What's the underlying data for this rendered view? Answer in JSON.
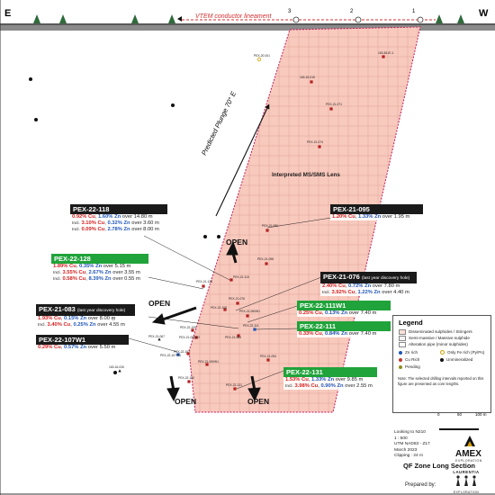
{
  "header": {
    "left_letter": "E",
    "right_letter": "W",
    "lineament_label": "VTEM conductor lineament",
    "markers": [
      "3",
      "2",
      "1"
    ]
  },
  "plunge_label": "Predicted Plunge 70° E",
  "lens_label": "Interpreted MS/SMS Lens",
  "open_labels": [
    "OPEN",
    "OPEN",
    "OPEN",
    "OPEN"
  ],
  "holes": [
    "PEX-20-001",
    "163-83-IE-1",
    "163-15-015",
    "PEX-21-071",
    "PEX-21-074",
    "PEX-21-080",
    "PEX-21-098",
    "PEX-21-128",
    "PEX-22-115",
    "PEX-21-076",
    "PEX-22-108",
    "PEX-21-080W1",
    "PEX-22-111",
    "PEX-22-109",
    "PEX-21-083",
    "PEX-21-090W2",
    "PEX-21-067",
    "PEX-22-107",
    "PEX-22-107W1",
    "PEX-21-090W1",
    "PEX-21-094",
    "PEX-22-100",
    "PEX-22-131",
    "163-16-026"
  ],
  "callouts": [
    {
      "id": "PEX-22-118",
      "style": "dark",
      "lines": [
        {
          "cu": "0.92% Cu",
          "zn": "1.60% Zn",
          "rest": "over 14.80 m"
        },
        {
          "pre": "Incl.",
          "cu": "3.10% Cu",
          "zn": "0.32% Zn",
          "rest": "over 3.60 m"
        },
        {
          "pre": "Incl.",
          "cu": "0.09% Cu",
          "zn": "2.78% Zn",
          "rest": "over 8.00 m"
        }
      ]
    },
    {
      "id": "PEX-21-095",
      "style": "dark",
      "lines": [
        {
          "cu": "1.20% Cu",
          "zn": "1.33% Zn",
          "rest": "over 1.95 m"
        }
      ]
    },
    {
      "id": "PEX-22-128",
      "style": "green",
      "lines": [
        {
          "cu": "1.89% Cu",
          "zn": "0.35% Zn",
          "rest": "over 5.15 m"
        },
        {
          "pre": "Incl.",
          "cu": "3.55% Cu",
          "zn": "2.67% Zn",
          "rest": "over 3.55 m"
        },
        {
          "pre": "Incl.",
          "cu": "0.58% Cu",
          "zn": "8.39% Zn",
          "rest": "over 0.55 m"
        }
      ]
    },
    {
      "id": "PEX-21-076",
      "note": "(last year discovery hole)",
      "style": "dark",
      "lines": [
        {
          "cu": "2.40% Cu",
          "zn": "0.72% Zn",
          "rest": "over 7.80 m"
        },
        {
          "pre": "Incl.",
          "cu": "3.92% Cu",
          "zn": "1.22% Zn",
          "rest": "over 4.40 m"
        }
      ]
    },
    {
      "id": "PEX-21-083",
      "note": "(last year discovery hole)",
      "style": "dark",
      "lines": [
        {
          "cu": "1.93% Cu",
          "zn": "0.15% Zn",
          "rest": "over 8.00 m"
        },
        {
          "pre": "Incl.",
          "cu": "3.40% Cu",
          "zn": "0.25% Zn",
          "rest": "over 4.55 m"
        }
      ]
    },
    {
      "id": "PEX-22-111W1",
      "style": "green",
      "lines": [
        {
          "cu": "0.25% Cu",
          "zn": "0.13% Zn",
          "rest": "over 7.40 m"
        }
      ]
    },
    {
      "id": "PEX-22-111",
      "style": "green",
      "lines": [
        {
          "cu": "0.33% Cu",
          "zn": "0.84% Zn",
          "rest": "over 7.40 m"
        }
      ]
    },
    {
      "id": "PEX-22-107W1",
      "style": "dark",
      "lines": [
        {
          "cu": "0.29% Cu",
          "zn": "0.57% Zn",
          "rest": "over 5.50 m"
        }
      ]
    },
    {
      "id": "PEX-22-131",
      "style": "green",
      "lines": [
        {
          "cu": "1.53% Cu",
          "zn": "1.33% Zn",
          "rest": "over 9.85 m"
        },
        {
          "pre": "Incl.",
          "cu": "3.98% Cu",
          "zn": "0.90% Zn",
          "rest": "over 2.55 m"
        }
      ]
    }
  ],
  "legend": {
    "title": "Legend",
    "items": [
      "Disseminated sulphides / Stringers",
      "Semi-massive / Massive sulphide",
      "Alteration pipe (minor sulphides)"
    ],
    "markers": [
      "Zn rich",
      "Only Fe rich (Py/Po)",
      "Cu Rich",
      "Unmineralized",
      "Pending"
    ],
    "note": "Note: The selected drilling intervals reported on this figure are presented as core lengths.",
    "scale_labels": [
      "0",
      "50",
      "100 m"
    ]
  },
  "info": [
    "Looking to N210",
    "1 : 500",
    "UTM NAD83 - Z17",
    "March 2023",
    "Clipping : 24 m"
  ],
  "company": "AMEX",
  "company_sub": "EXPLORATION",
  "section_title": "QF Zone Long Section",
  "prepared_by": "Prepared by:",
  "preparer": "LAURENTIA",
  "preparer_sub": "EXPLORATION",
  "colors": {
    "cu": "#d42020",
    "zn": "#1f55b8",
    "green": "#20a33a",
    "dark": "#1a1a1a",
    "lens_fill": "#f8c9bd",
    "lens_edge": "#c2185b"
  }
}
